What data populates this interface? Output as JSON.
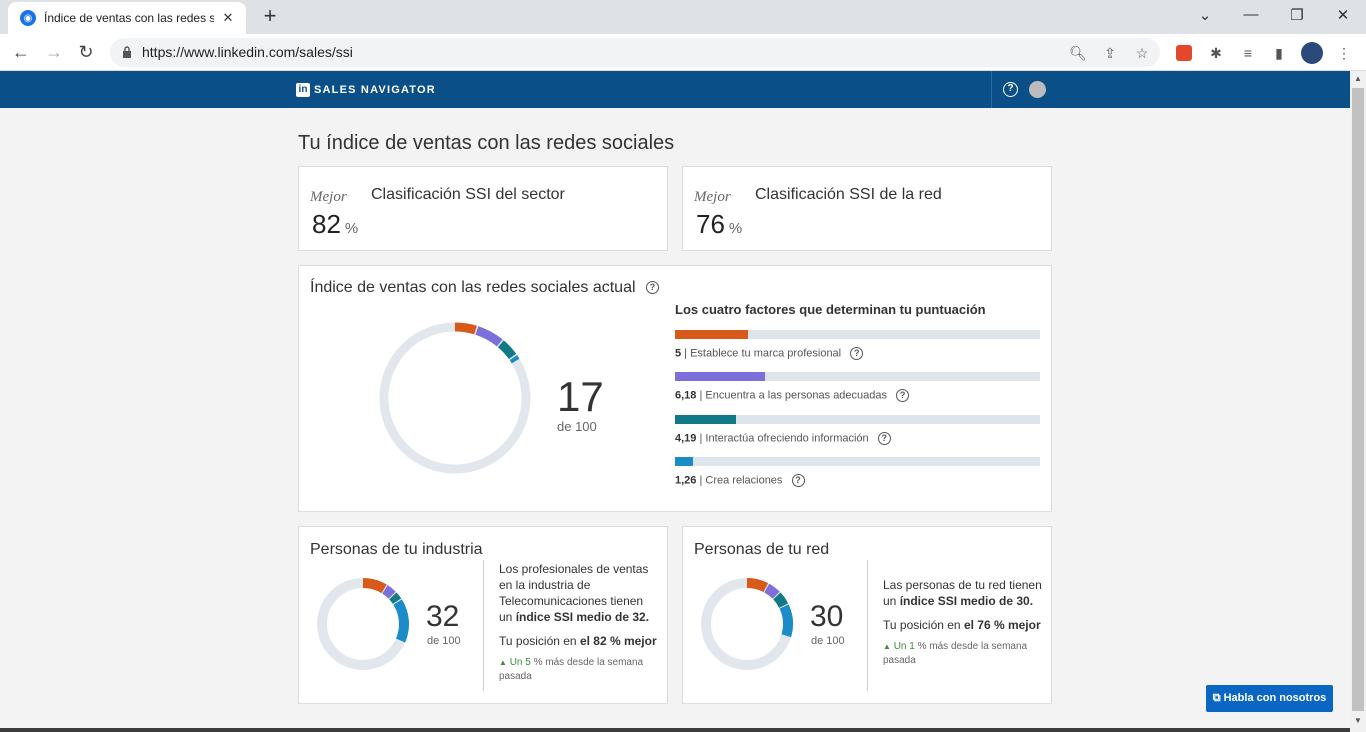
{
  "browser": {
    "tab_title": "Índice de ventas con las redes so",
    "url": "https://www.linkedin.com/sales/ssi"
  },
  "header": {
    "brand": "SALES NAVIGATOR",
    "logo_text": "in",
    "help": "?"
  },
  "page": {
    "title": "Tu índice de ventas con las redes sociales"
  },
  "rank_cards": [
    {
      "best": "Mejor",
      "label": "Clasificación SSI del sector",
      "value": "82",
      "unit": "%"
    },
    {
      "best": "Mejor",
      "label": "Clasificación SSI de la red",
      "value": "76",
      "unit": "%"
    }
  ],
  "current": {
    "title": "Índice de ventas con las redes sociales actual",
    "score": "17",
    "out_of": "de 100",
    "factors_title": "Los cuatro factores que determinan tu puntuación",
    "factors": [
      {
        "value": "5",
        "label": "| Establece tu marca profesional",
        "score": 5,
        "max": 25,
        "color": "#d85a1a"
      },
      {
        "value": "6,18",
        "label": "| Encuentra a las personas adecuadas",
        "score": 6.18,
        "max": 25,
        "color": "#7c6fdb"
      },
      {
        "value": "4,19",
        "label": "| Interactúa ofreciendo información",
        "score": 4.19,
        "max": 25,
        "color": "#127a86"
      },
      {
        "value": "1,26",
        "label": "| Crea relaciones",
        "score": 1.26,
        "max": 25,
        "color": "#1a8cc7"
      }
    ]
  },
  "industry": {
    "title": "Personas de tu industria",
    "score": "32",
    "out_of": "de 100",
    "desc_1": "Los profesionales de ventas en la industria de Telecomunicaciones tienen un ",
    "desc_bold": "índice SSI medio de 32.",
    "rank_prefix": "Tu posición en ",
    "rank_bold": "el 82 % mejor",
    "trend_bold": "Un 5",
    "trend_rest": " % más desde la semana pasada",
    "segments": [
      9,
      4,
      3,
      16
    ]
  },
  "network": {
    "title": "Personas de tu red",
    "score": "30",
    "out_of": "de 100",
    "desc_1": "Las personas de tu red tienen un ",
    "desc_bold": "índice SSI medio de 30.",
    "rank_prefix": "Tu posición en ",
    "rank_bold": "el 76 % mejor",
    "trend_bold": "Un 1",
    "trend_rest": " % más desde la semana pasada",
    "segments": [
      8,
      5,
      5,
      12
    ]
  },
  "chat_button": "Habla con nosotros",
  "colors": {
    "linkedin_blue": "#0a4f87",
    "ring_track": "#e1e7ec"
  }
}
